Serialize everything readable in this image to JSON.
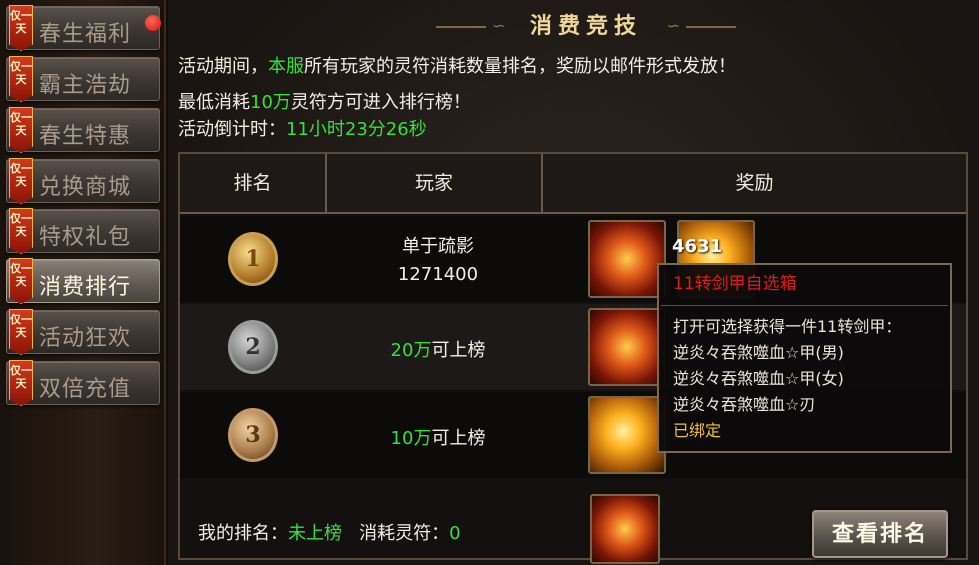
{
  "sidebar": {
    "tag_text": "仅一天",
    "items": [
      {
        "label": "春生福利",
        "notification": true
      },
      {
        "label": "霸主浩劫"
      },
      {
        "label": "春生特惠"
      },
      {
        "label": "兑换商城"
      },
      {
        "label": "特权礼包"
      },
      {
        "label": "消费排行",
        "active": true
      },
      {
        "label": "活动狂欢"
      },
      {
        "label": "双倍充值"
      }
    ]
  },
  "header": {
    "title": "消费竞技"
  },
  "info": {
    "line1_prefix": "活动期间，",
    "line1_highlight": "本服",
    "line1_suffix": "所有玩家的灵符消耗数量排名，奖励以邮件形式发放！",
    "line2_prefix": "最低消耗",
    "line2_highlight": "10万",
    "line2_suffix": "灵符方可进入排行榜！",
    "countdown_label": "活动倒计时：",
    "countdown_value": "11小时23分26秒"
  },
  "table": {
    "headers": [
      "排名",
      "玩家",
      "奖励"
    ],
    "rows": [
      {
        "rank": "1",
        "medal": "gold",
        "player_name": "单于疏影",
        "player_value": "1271400"
      },
      {
        "rank": "2",
        "medal": "silver",
        "threshold": "20万",
        "threshold_suffix": "可上榜"
      },
      {
        "rank": "3",
        "medal": "bronze",
        "threshold": "10万",
        "threshold_suffix": "可上榜"
      }
    ],
    "reward_count": "4631"
  },
  "footer": {
    "my_rank_label": "我的排名：",
    "my_rank_value": "未上榜",
    "consumed_label": "消耗灵符：",
    "consumed_value": "0",
    "view_button": "查看排名"
  },
  "tooltip": {
    "title": "11转剑甲自选箱",
    "desc": "打开可选择获得一件11转剑甲：",
    "options": [
      "逆炎々吞煞噬血☆甲(男)",
      "逆炎々吞煞噬血☆甲(女)",
      "逆炎々吞煞噬血☆刃"
    ],
    "bound": "已绑定"
  },
  "colors": {
    "highlight_green": "#35e03a",
    "tooltip_title_red": "#e01a1a",
    "bound_yellow": "#f0c22a"
  }
}
